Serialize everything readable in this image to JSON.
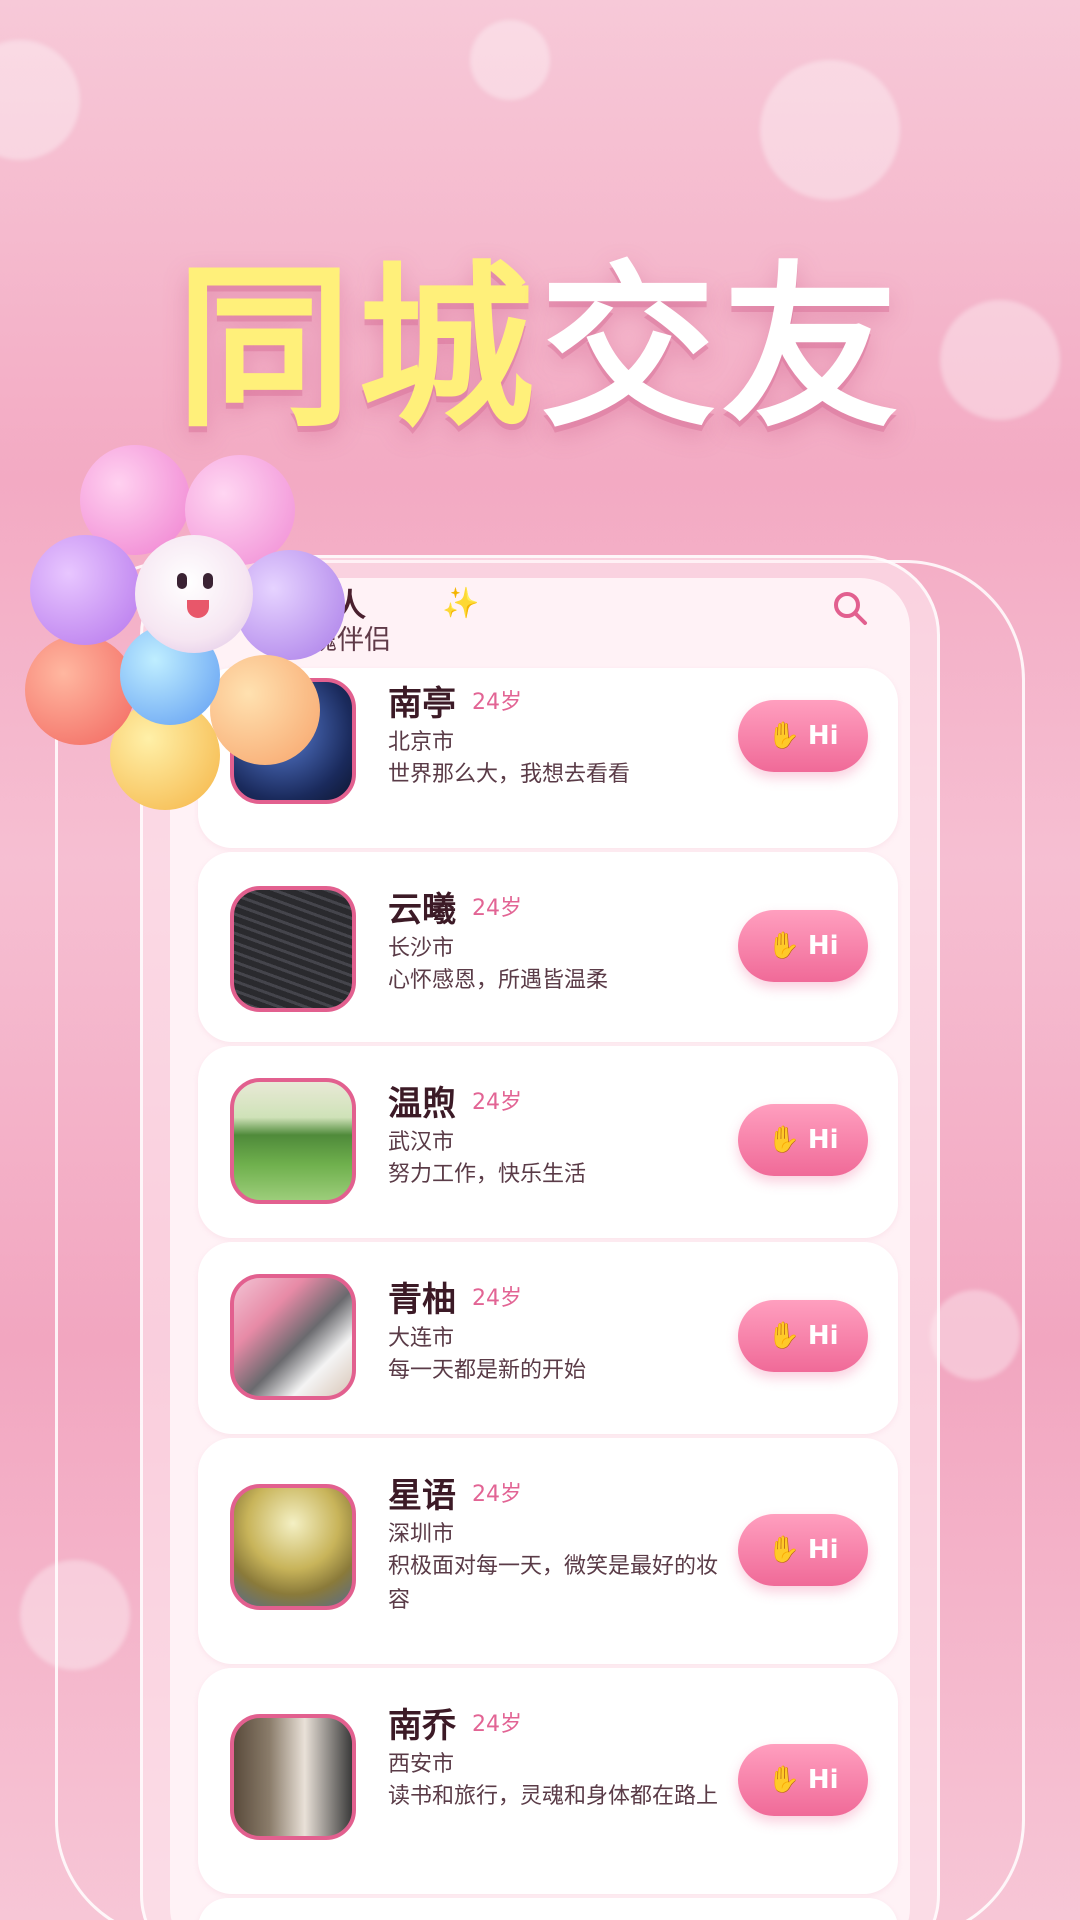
{
  "headline": {
    "part1": "同城",
    "part2": "交友"
  },
  "header": {
    "title": "趣的人",
    "subtitle": "魂伴侣",
    "sparkle_icon": "sparkle-icon",
    "search_icon": "search-icon"
  },
  "hi_button": {
    "label": "Hi",
    "icon": "wave-hand-icon"
  },
  "users": [
    {
      "name": "南亭",
      "age": "24岁",
      "city": "北京市",
      "bio": "世界那么大，我想去看看"
    },
    {
      "name": "云曦",
      "age": "24岁",
      "city": "长沙市",
      "bio": "心怀感恩，所遇皆温柔"
    },
    {
      "name": "温煦",
      "age": "24岁",
      "city": "武汉市",
      "bio": "努力工作，快乐生活"
    },
    {
      "name": "青柚",
      "age": "24岁",
      "city": "大连市",
      "bio": "每一天都是新的开始"
    },
    {
      "name": "星语",
      "age": "24岁",
      "city": "深圳市",
      "bio": "积极面对每一天，微笑是最好的妆容"
    },
    {
      "name": "南乔",
      "age": "24岁",
      "city": "西安市",
      "bio": "读书和旅行，灵魂和身体都在路上"
    }
  ],
  "colors": {
    "accent": "#f06a98",
    "headline_yellow": "#fff07a",
    "name_text": "#3c1a26"
  }
}
